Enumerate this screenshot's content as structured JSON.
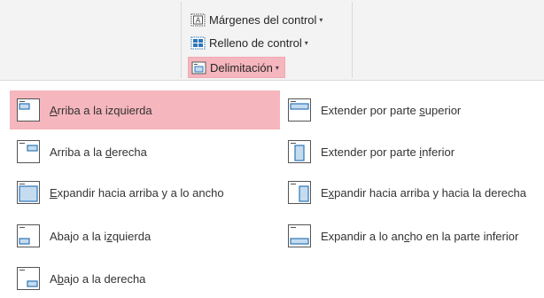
{
  "ribbon": {
    "margins_label": "Márgenes del control",
    "padding_label": "Relleno de control",
    "anchoring_label": "Delimitación",
    "caret": "▾"
  },
  "menu": {
    "items": [
      {
        "pre": "",
        "key": "A",
        "post": "rriba a la izquierda",
        "icon": "anchor-top-left-icon",
        "highlighted": true
      },
      {
        "pre": "Arriba a la ",
        "key": "d",
        "post": "erecha",
        "icon": "anchor-top-right-icon"
      },
      {
        "pre": "",
        "key": "E",
        "post": "xpandir hacia arriba y a lo ancho",
        "icon": "stretch-down-across-icon"
      },
      {
        "pre": "Abajo a la i",
        "key": "z",
        "post": "quierda",
        "icon": "anchor-bottom-left-icon"
      },
      {
        "pre": "A",
        "key": "b",
        "post": "ajo a la derecha",
        "icon": "anchor-bottom-right-icon"
      },
      {
        "pre": "Extender por parte ",
        "key": "s",
        "post": "uperior",
        "icon": "stretch-across-top-icon"
      },
      {
        "pre": "Extender por parte ",
        "key": "i",
        "post": "nferior",
        "icon": "stretch-down-icon"
      },
      {
        "pre": "E",
        "key": "x",
        "post": "pandir hacia arriba y hacia la derecha",
        "icon": "stretch-down-right-icon"
      },
      {
        "pre": "Expandir a lo an",
        "key": "c",
        "post": "ho en la parte inferior",
        "icon": "stretch-across-bottom-icon"
      }
    ]
  },
  "colors": {
    "highlight": "#f5b6bd",
    "icon_blue": "#2e75b6",
    "icon_fill": "#c5dcf0",
    "ribbon_bg": "#f3f3f3"
  }
}
